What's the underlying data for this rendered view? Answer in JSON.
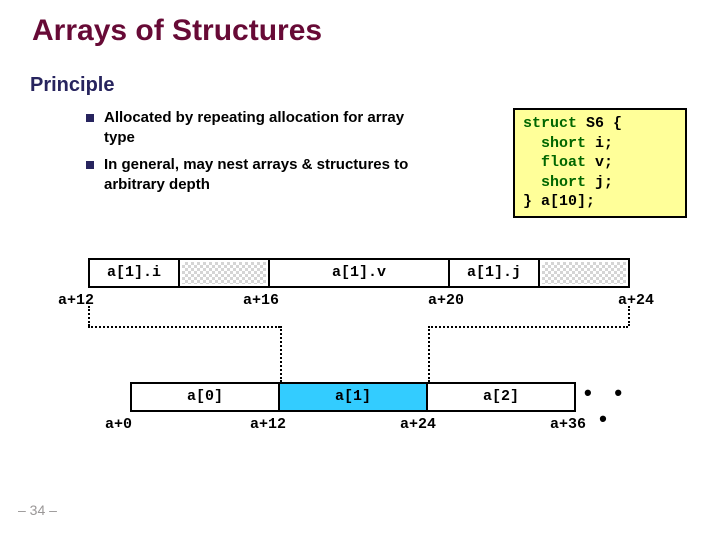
{
  "title": "Arrays of Structures",
  "subhead": "Principle",
  "bullets": [
    "Allocated by repeating allocation for array type",
    "In general, may nest arrays & structures to arbitrary depth"
  ],
  "code": {
    "l1a": "struct",
    "l1b": " S6 {",
    "l2a": "  short",
    "l2b": " i;",
    "l3a": "  float",
    "l3b": " v;",
    "l4a": "  short",
    "l4b": " j;",
    "l5": "} a[10];"
  },
  "d1": {
    "cells": [
      "a[1].i",
      "",
      "a[1].v",
      "a[1].j",
      ""
    ],
    "offsets": [
      "a+12",
      "a+16",
      "a+20",
      "a+24"
    ]
  },
  "d2": {
    "cells": [
      "a[0]",
      "a[1]",
      "a[2]"
    ],
    "ellipsis": "• • •",
    "offsets": [
      "a+0",
      "a+12",
      "a+24",
      "a+36"
    ]
  },
  "footer": "– 34 –"
}
